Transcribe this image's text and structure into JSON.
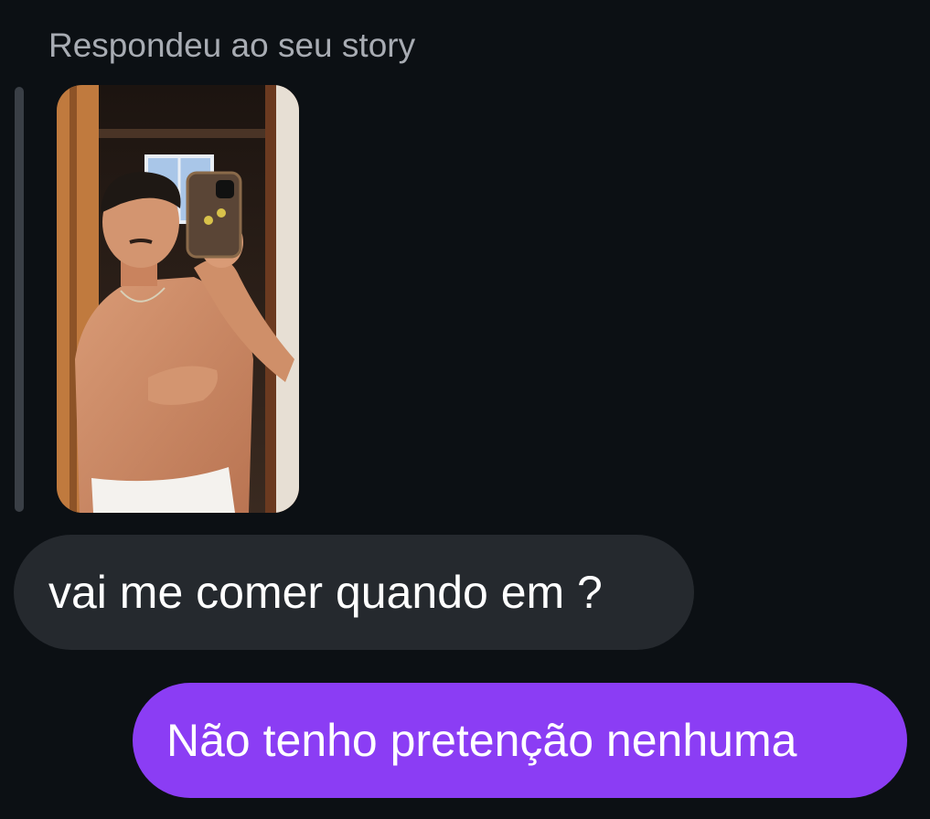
{
  "reply_context": {
    "label": "Respondeu ao seu story",
    "story_image_icon": "photo-icon"
  },
  "messages": [
    {
      "direction": "received",
      "text": "vai me comer quando em ?"
    },
    {
      "direction": "sent",
      "text": "Não tenho pretenção nenhuma"
    }
  ],
  "colors": {
    "background": "#0c1014",
    "received_bubble": "#25292e",
    "sent_bubble": "#8b3df4",
    "label_text": "#a8acb3",
    "reply_bar": "#3a3f46"
  }
}
